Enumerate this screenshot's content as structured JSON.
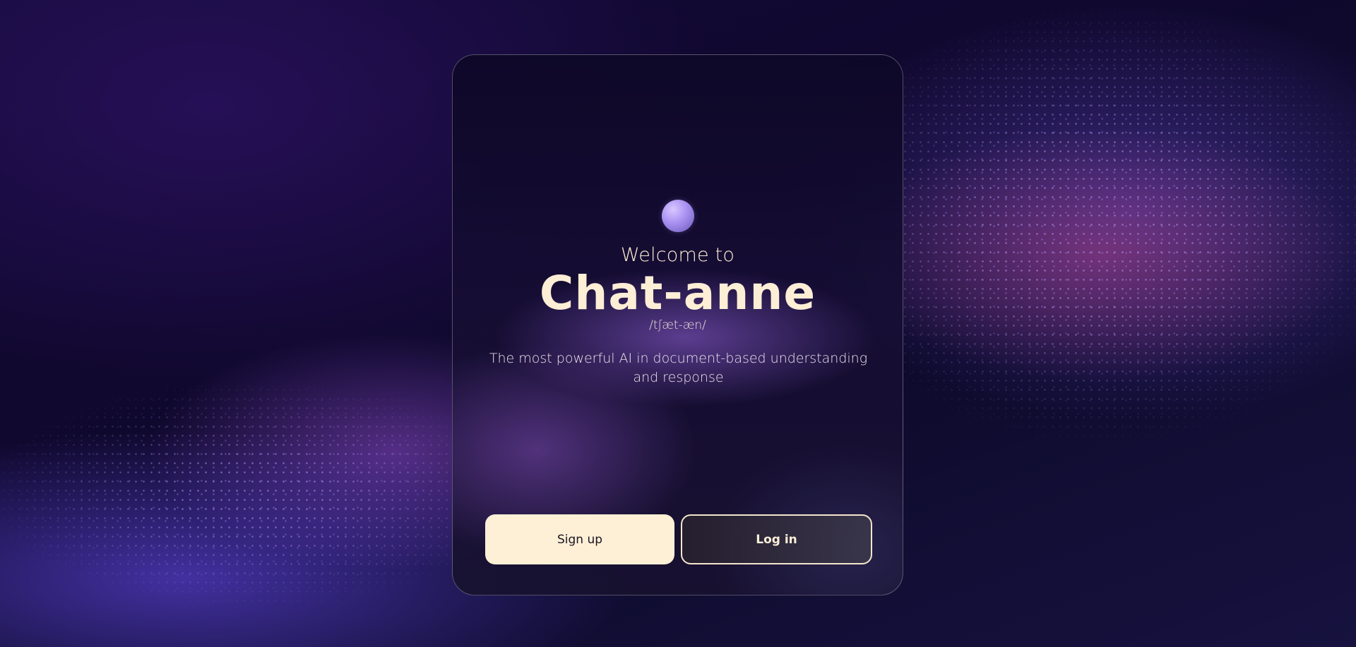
{
  "welcome_text": "Welcome to",
  "app_name": "Chat-anne",
  "phonetic": "/tʃæt-æn/",
  "tagline": "The most powerful AI in document-based understanding and response",
  "buttons": {
    "signup_label": "Sign up",
    "login_label": "Log in"
  },
  "colors": {
    "accent_cream": "#fdf0d6",
    "text_cream": "#fdeed6",
    "background_dark": "#10082e",
    "orb_purple": "#a890f0"
  },
  "icons": {
    "logo": "purple-orb-logo"
  }
}
